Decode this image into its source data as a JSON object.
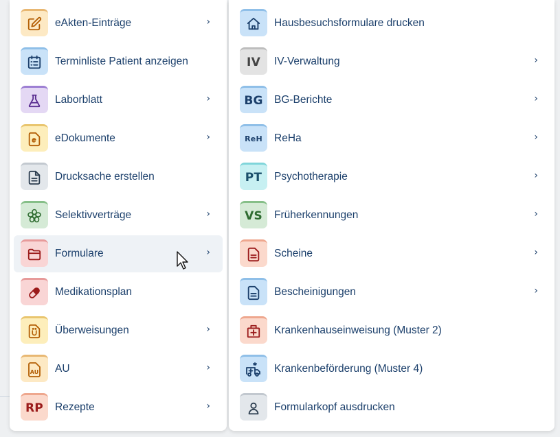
{
  "left_menu": {
    "items": [
      {
        "label": "eAkten-Einträge",
        "icon": "edit-icon",
        "has_submenu": true
      },
      {
        "label": "Terminliste Patient anzeigen",
        "icon": "calendar-list-icon",
        "has_submenu": false
      },
      {
        "label": "Laborblatt",
        "icon": "flask-icon",
        "has_submenu": true
      },
      {
        "label": "eDokumente",
        "icon": "e-document-icon",
        "has_submenu": true
      },
      {
        "label": "Drucksache erstellen",
        "icon": "document-icon",
        "has_submenu": false
      },
      {
        "label": "Selektivverträge",
        "icon": "flower-icon",
        "has_submenu": true
      },
      {
        "label": "Formulare",
        "icon": "folder-icon",
        "has_submenu": true,
        "hovered": true
      },
      {
        "label": "Medikationsplan",
        "icon": "pill-icon",
        "has_submenu": false
      },
      {
        "label": "Überweisungen",
        "icon": "referral-document-icon",
        "has_submenu": true
      },
      {
        "label": "AU",
        "icon": "au-document-icon",
        "icon_text": "AU",
        "has_submenu": true
      },
      {
        "label": "Rezepte",
        "icon": "rp-badge-icon",
        "icon_text": "RP",
        "has_submenu": true
      }
    ]
  },
  "right_menu": {
    "items": [
      {
        "label": "Hausbesuchsformulare drucken",
        "icon": "house-icon",
        "has_submenu": false
      },
      {
        "label": "IV-Verwaltung",
        "icon": "iv-badge-icon",
        "icon_text": "IV",
        "has_submenu": true
      },
      {
        "label": "BG-Berichte",
        "icon": "bg-badge-icon",
        "icon_text": "BG",
        "has_submenu": true
      },
      {
        "label": "ReHa",
        "icon": "reh-badge-icon",
        "icon_text": "ReH",
        "has_submenu": true
      },
      {
        "label": "Psychotherapie",
        "icon": "pt-badge-icon",
        "icon_text": "PT",
        "has_submenu": true
      },
      {
        "label": "Früherkennungen",
        "icon": "vs-badge-icon",
        "icon_text": "VS",
        "has_submenu": true
      },
      {
        "label": "Scheine",
        "icon": "document-icon",
        "has_submenu": true
      },
      {
        "label": "Bescheinigungen",
        "icon": "document-icon",
        "has_submenu": true
      },
      {
        "label": "Krankenhauseinweisung (Muster 2)",
        "icon": "hospital-icon",
        "has_submenu": false
      },
      {
        "label": "Krankenbeförderung (Muster 4)",
        "icon": "ambulance-icon",
        "has_submenu": false
      },
      {
        "label": "Formularkopf ausdrucken",
        "icon": "person-icon",
        "has_submenu": false
      }
    ]
  },
  "chevron": "›",
  "colors": {
    "text": "#1b3f6b",
    "hover_background": "#eef2f6",
    "panel_background": "#ffffff"
  }
}
